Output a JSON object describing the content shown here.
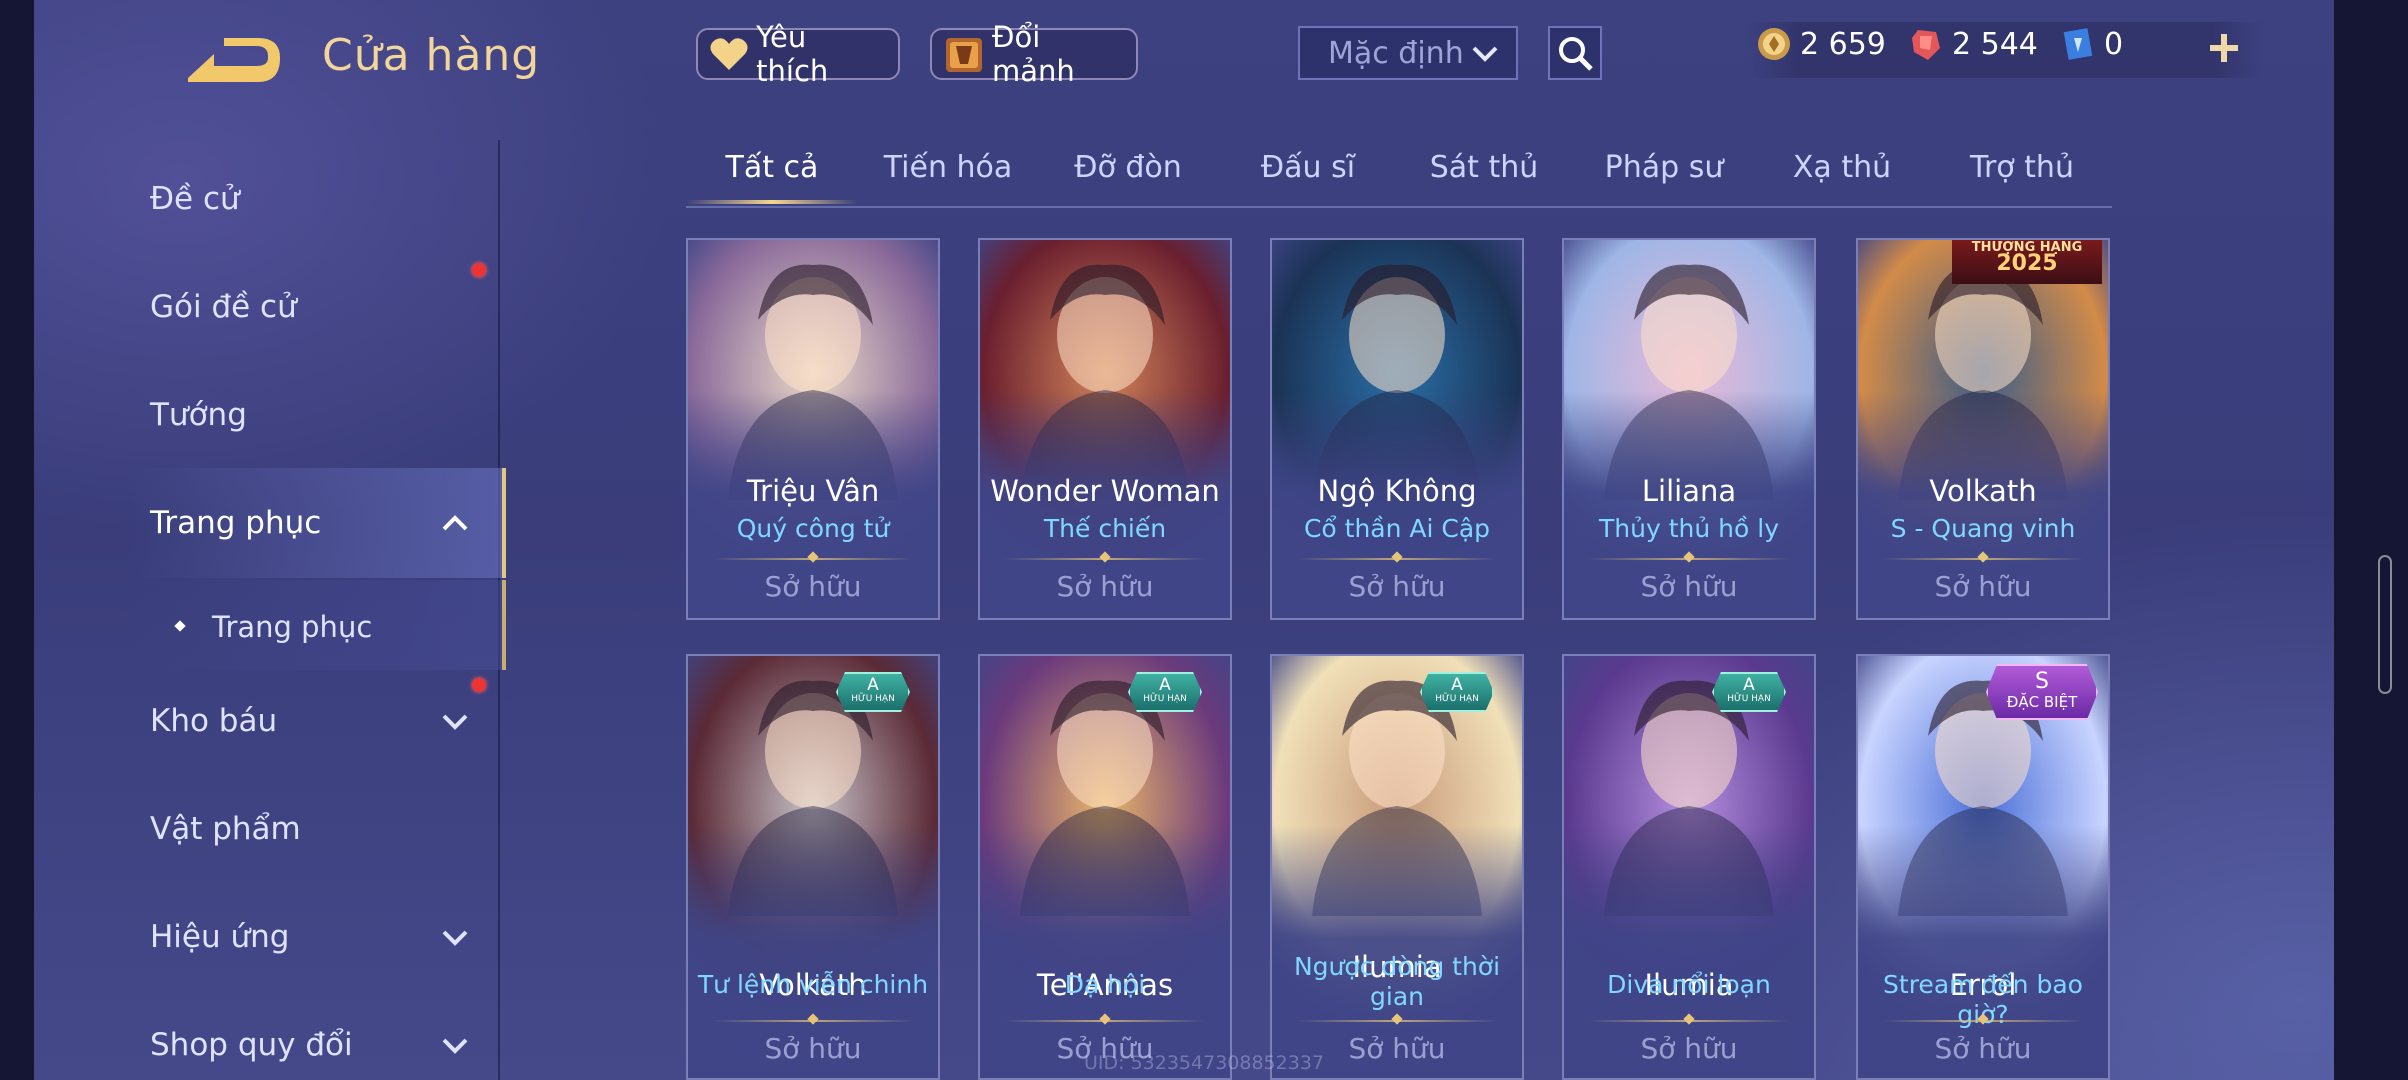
{
  "header": {
    "title": "Cửa hàng",
    "favorite_label": "Yêu thích",
    "shard_label": "Đổi mảnh",
    "sort_value": "Mặc định"
  },
  "currencies": [
    {
      "name": "gold-coin",
      "value": "2 659",
      "color": "#e9c06a"
    },
    {
      "name": "ruby",
      "value": "2 544",
      "color": "#e2585a"
    },
    {
      "name": "voucher",
      "value": "0",
      "color": "#7ab5ff"
    }
  ],
  "sidebar": {
    "items": [
      {
        "label": "Đề cử"
      },
      {
        "label": "Gói đề cử"
      },
      {
        "label": "Tướng"
      },
      {
        "label": "Trang phục"
      },
      {
        "label": "Trang phục"
      },
      {
        "label": "Kho báu"
      },
      {
        "label": "Vật phẩm"
      },
      {
        "label": "Hiệu ứng"
      },
      {
        "label": "Shop quy đổi"
      }
    ]
  },
  "tabs": [
    "Tất cả",
    "Tiến hóa",
    "Đỡ đòn",
    "Đấu sĩ",
    "Sát thủ",
    "Pháp sư",
    "Xạ thủ",
    "Trợ thủ"
  ],
  "cards": [
    {
      "hero": "Triệu Vân",
      "skin": "Quý công tử",
      "status": "Sở hữu",
      "palette": [
        "#e9d9c7",
        "#8a6a9a"
      ]
    },
    {
      "hero": "Wonder Woman",
      "skin": "Thế chiến",
      "status": "Sở hữu",
      "palette": [
        "#d2855a",
        "#6a1f2f"
      ]
    },
    {
      "hero": "Ngộ Không",
      "skin": "Cổ thần Ai Cập",
      "status": "Sở hữu",
      "palette": [
        "#2a6fa8",
        "#1b3355"
      ]
    },
    {
      "hero": "Liliana",
      "skin": "Thủy thủ hồ ly",
      "status": "Sở hữu",
      "palette": [
        "#e9b9d8",
        "#9fb6e6"
      ]
    },
    {
      "hero": "Volkath",
      "skin": "S - Quang vinh",
      "status": "Sở hữu",
      "palette": [
        "#3b5c8a",
        "#d28b48"
      ],
      "badge": "rank",
      "badge_top": "THƯỢNG HẠNG",
      "badge_bottom": "2025"
    },
    {
      "hero": "Volkath",
      "skin": "Tư lệnh viễn chinh",
      "status": "Sở hữu",
      "palette": [
        "#c9c3c9",
        "#5a2a36"
      ],
      "badge": "A",
      "badge_sub": "HỮU HẠN"
    },
    {
      "hero": "Tel'Annas",
      "skin": "Dạ hội",
      "status": "Sở hữu",
      "palette": [
        "#e9b56a",
        "#6b3a7c"
      ],
      "badge": "A",
      "badge_sub": "HỮU HẠN"
    },
    {
      "hero": "Ilumia",
      "skin": "Ngược dòng thời gian",
      "status": "Sở hữu",
      "palette": [
        "#c99a7a",
        "#f0e0b8"
      ],
      "badge": "A",
      "badge_sub": "HỮU HẠN"
    },
    {
      "hero": "Ilumia",
      "skin": "Diva nổi loạn",
      "status": "Sở hữu",
      "palette": [
        "#b58ee0",
        "#5a3a8e"
      ],
      "badge": "A",
      "badge_sub": "HỮU HẠN"
    },
    {
      "hero": "Errol",
      "skin": "Stream đến bao giờ?",
      "status": "Sở hữu",
      "palette": [
        "#4b6fd8",
        "#c9d4ff"
      ],
      "badge": "S",
      "badge_sub": "ĐẶC BIỆT"
    }
  ],
  "uid": "UID: 5323547308852337"
}
